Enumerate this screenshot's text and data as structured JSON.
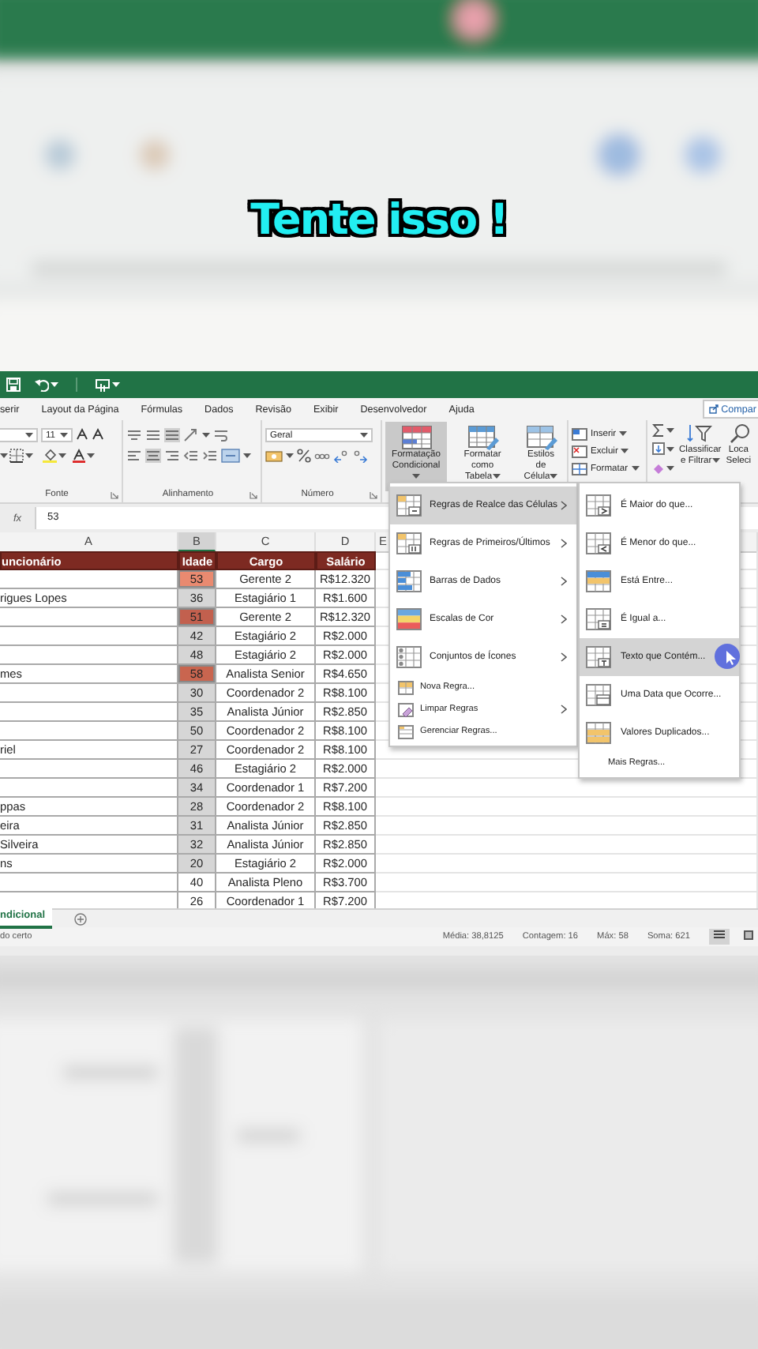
{
  "caption": "Tente isso !",
  "ribbon_tabs": [
    "serir",
    "Layout da Página",
    "Fórmulas",
    "Dados",
    "Revisão",
    "Exibir",
    "Desenvolvedor",
    "Ajuda"
  ],
  "share_button": "Compar",
  "ribbon": {
    "font_size": "11",
    "font_group_label": "Fonte",
    "alignment_group_label": "Alinhamento",
    "number_format": "Geral",
    "number_group_label": "Número",
    "style_buttons": [
      {
        "lines": [
          "Formatação",
          "Condicional"
        ],
        "selected": true
      },
      {
        "lines": [
          "Formatar como",
          "Tabela"
        ],
        "selected": false
      },
      {
        "lines": [
          "Estilos de",
          "Célula"
        ],
        "selected": false
      }
    ],
    "cell_buttons": [
      "Inserir",
      "Excluir",
      "Formatar"
    ],
    "sort_button": [
      "Classificar",
      "e Filtrar"
    ],
    "find_button": [
      "Loca",
      "Seleci"
    ]
  },
  "formula_bar": {
    "function_label": "fx",
    "value": "53"
  },
  "columns": [
    {
      "label": "A",
      "selected": false
    },
    {
      "label": "B",
      "selected": true
    },
    {
      "label": "C",
      "selected": false
    },
    {
      "label": "D",
      "selected": false
    },
    {
      "label": "E",
      "selected": false
    }
  ],
  "table": {
    "headers": [
      "uncionário",
      "Idade",
      "Cargo",
      "Salário"
    ],
    "rows": [
      {
        "age": "53",
        "role": "Gerente 2",
        "salary": "R$12.320",
        "selected": true,
        "color": "#e98a70"
      },
      {
        "name": "rigues Lopes",
        "age": "36",
        "role": "Estagiário 1",
        "salary": "R$1.600",
        "selected": true
      },
      {
        "age": "51",
        "role": "Gerente 2",
        "salary": "R$12.320",
        "selected": true,
        "color": "#c2604e"
      },
      {
        "age": "42",
        "role": "Estagiário 2",
        "salary": "R$2.000",
        "selected": true
      },
      {
        "age": "48",
        "role": "Estagiário 2",
        "salary": "R$2.000",
        "selected": true
      },
      {
        "name": "mes",
        "age": "58",
        "role": "Analista Senior",
        "salary": "R$4.650",
        "selected": true,
        "color": "#c9654f"
      },
      {
        "age": "30",
        "role": "Coordenador 2",
        "salary": "R$8.100",
        "selected": true
      },
      {
        "age": "35",
        "role": "Analista Júnior",
        "salary": "R$2.850",
        "selected": true
      },
      {
        "age": "50",
        "role": "Coordenador 2",
        "salary": "R$8.100",
        "selected": true
      },
      {
        "name": "riel",
        "age": "27",
        "role": "Coordenador 2",
        "salary": "R$8.100",
        "selected": true
      },
      {
        "age": "46",
        "role": "Estagiário 2",
        "salary": "R$2.000",
        "selected": true
      },
      {
        "age": "34",
        "role": "Coordenador 1",
        "salary": "R$7.200",
        "selected": true
      },
      {
        "name": "ppas",
        "age": "28",
        "role": "Coordenador 2",
        "salary": "R$8.100",
        "selected": true
      },
      {
        "name": "eira",
        "age": "31",
        "role": "Analista Júnior",
        "salary": "R$2.850",
        "selected": true
      },
      {
        "name": "Silveira",
        "age": "32",
        "role": "Analista Júnior",
        "salary": "R$2.850",
        "selected": true
      },
      {
        "name": "ns",
        "age": "20",
        "role": "Estagiário 2",
        "salary": "R$2.000",
        "selected": true
      },
      {
        "age": "40",
        "role": "Analista Pleno",
        "salary": "R$3.700",
        "selected": false
      },
      {
        "age": "26",
        "role": "Coordenador 1",
        "salary": "R$7.200",
        "selected": false
      }
    ]
  },
  "sheet_tab": {
    "label": "ndicional",
    "selected": true
  },
  "status_bar": {
    "left": "do certo",
    "items": [
      "Média: 38,8125",
      "Contagem: 16",
      "Máx: 58",
      "Soma: 621"
    ]
  },
  "menu": {
    "items": [
      {
        "label": "Regras de Realce das Células",
        "kind": "large",
        "selected": true,
        "submenu": true
      },
      {
        "label": "Regras de Primeiros/Últimos",
        "kind": "large",
        "selected": false,
        "submenu": true
      },
      {
        "label": "Barras de Dados",
        "kind": "large",
        "selected": false,
        "submenu": true
      },
      {
        "label": "Escalas de Cor",
        "kind": "large",
        "selected": false,
        "submenu": true
      },
      {
        "label": "Conjuntos de Ícones",
        "kind": "large",
        "selected": false,
        "submenu": true
      },
      {
        "label": "Nova Regra...",
        "kind": "small",
        "selected": false,
        "submenu": false
      },
      {
        "label": "Limpar Regras",
        "kind": "small",
        "selected": false,
        "submenu": true
      },
      {
        "label": "Gerenciar Regras...",
        "kind": "small",
        "selected": false,
        "submenu": false
      }
    ]
  },
  "submenu": {
    "items": [
      {
        "label": "É Maior do que...",
        "selected": false
      },
      {
        "label": "É Menor do que...",
        "selected": false
      },
      {
        "label": "Está Entre...",
        "selected": false
      },
      {
        "label": "É Igual a...",
        "selected": false
      },
      {
        "label": "Texto que Contém...",
        "selected": true
      },
      {
        "label": "Uma Data que Ocorre...",
        "selected": false
      },
      {
        "label": "Valores Duplicados...",
        "selected": false
      }
    ],
    "footer": "Mais Regras..."
  }
}
